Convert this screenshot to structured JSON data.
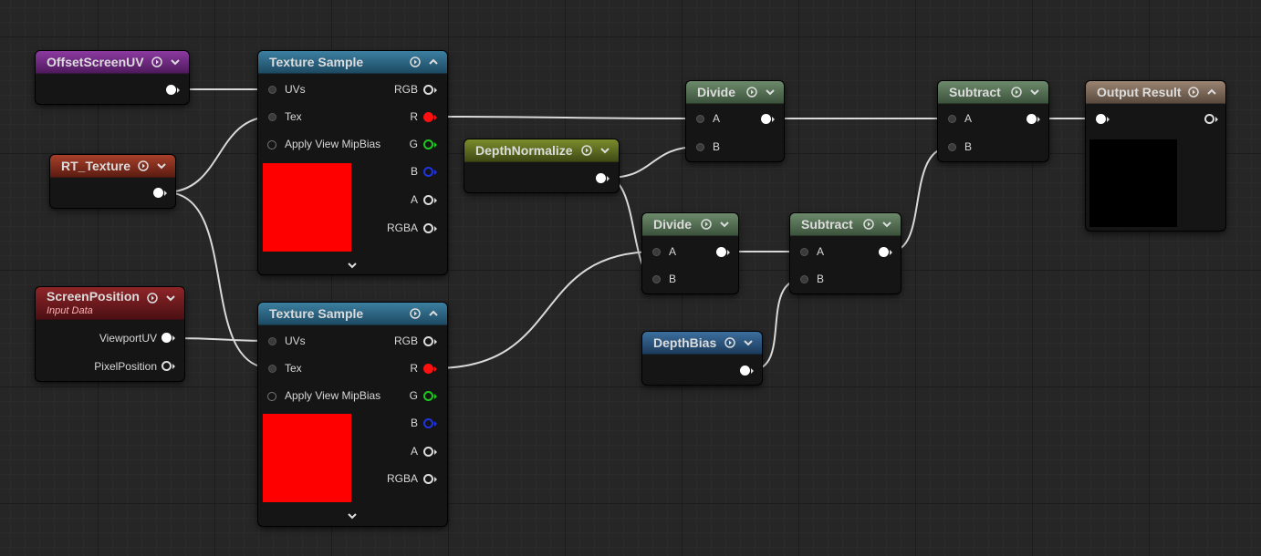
{
  "theme": {
    "wire_color": "#d9d9d9",
    "pin_red": "#ff1010",
    "pin_green": "#1ec81e",
    "pin_blue": "#2035e0"
  },
  "nodes": {
    "offset_screen_uv": {
      "title": "OffsetScreenUV"
    },
    "rt_texture": {
      "title": "RT_Texture"
    },
    "screen_position": {
      "title": "ScreenPosition",
      "subtitle": "Input Data",
      "outputs": [
        "ViewportUV",
        "PixelPosition"
      ]
    },
    "texture_sample_1": {
      "title": "Texture Sample",
      "inputs": [
        "UVs",
        "Tex",
        "Apply View MipBias"
      ],
      "outputs": [
        "RGB",
        "R",
        "G",
        "B",
        "A",
        "RGBA"
      ],
      "preview_color": "#ff0000"
    },
    "texture_sample_2": {
      "title": "Texture Sample",
      "inputs": [
        "UVs",
        "Tex",
        "Apply View MipBias"
      ],
      "outputs": [
        "RGB",
        "R",
        "G",
        "B",
        "A",
        "RGBA"
      ],
      "preview_color": "#ff0000"
    },
    "depth_normalize": {
      "title": "DepthNormalize"
    },
    "divide_1": {
      "title": "Divide",
      "inputs": [
        "A",
        "B"
      ]
    },
    "divide_2": {
      "title": "Divide",
      "inputs": [
        "A",
        "B"
      ]
    },
    "subtract_1": {
      "title": "Subtract",
      "inputs": [
        "A",
        "B"
      ]
    },
    "subtract_2": {
      "title": "Subtract",
      "inputs": [
        "A",
        "B"
      ]
    },
    "depth_bias": {
      "title": "DepthBias"
    },
    "output_result": {
      "title": "Output Result",
      "preview_color": "#000000"
    }
  }
}
